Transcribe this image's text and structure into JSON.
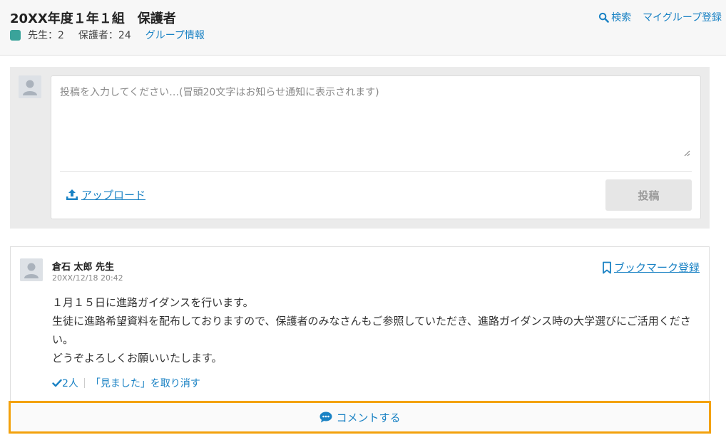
{
  "header": {
    "title": "20XX年度１年１組　保護者",
    "teachers_label": "先生：2",
    "guardians_label": "保護者：24",
    "group_info_link": "グループ情報",
    "legend_color": "#3aa39a",
    "search_icon": "search-icon",
    "search_label": "検索",
    "my_group_label": "マイグループ登録"
  },
  "compose": {
    "placeholder": "投稿を入力してください…(冒頭20文字はお知らせ通知に表示されます)",
    "value": "",
    "upload_icon": "upload-icon",
    "upload_label": "アップロード",
    "post_button": "投稿"
  },
  "post": {
    "author": "倉石 太郎 先生",
    "date": "20XX/12/18 20:42",
    "bookmark_icon": "bookmark-icon",
    "bookmark_label": "ブックマーク登録",
    "body": [
      "１月１５日に進路ガイダンスを行います。",
      "生徒に進路希望資料を配布しておりますので、保護者のみなさんもご参照していただき、進路ガイダンス時の大学選びにご活用ください。",
      "どうぞよろしくお願いいたします。"
    ],
    "seen_icon": "check-icon",
    "seen_count": "2人",
    "undo_seen": "「見ました」を取り消す"
  },
  "comment": {
    "icon": "comment-icon",
    "label": "コメントする"
  },
  "colors": {
    "accent": "#1a82c4",
    "highlight": "#f3a10c"
  }
}
